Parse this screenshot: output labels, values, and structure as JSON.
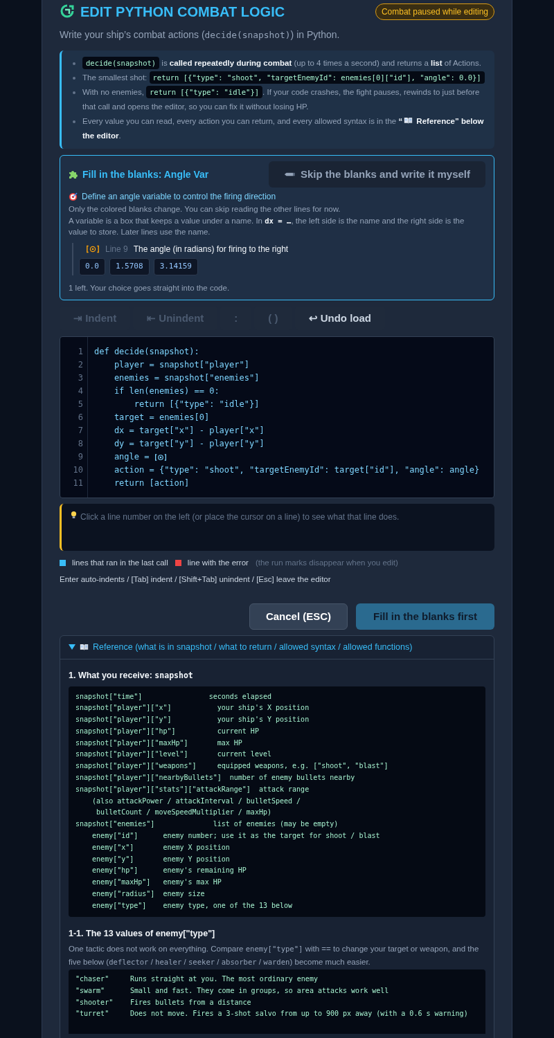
{
  "header": {
    "title": "EDIT PYTHON COMBAT LOGIC",
    "badge": "Combat paused while editing",
    "subtitle": [
      {
        "kind": "text",
        "text": "Write your ship’s combat actions ("
      },
      {
        "kind": "mono",
        "text": "decide(snapshot)"
      },
      {
        "kind": "text",
        "text": ") in Python."
      }
    ]
  },
  "notes": [
    [
      {
        "kind": "code",
        "text": "decide(snapshot)"
      },
      {
        "kind": "text",
        "text": " is "
      },
      {
        "kind": "bold",
        "text": "called repeatedly during combat"
      },
      {
        "kind": "text",
        "text": " (up to 4 times a second) and returns a "
      },
      {
        "kind": "bold",
        "text": "list"
      },
      {
        "kind": "text",
        "text": " of Actions."
      }
    ],
    [
      {
        "kind": "text",
        "text": "The smallest shot: "
      },
      {
        "kind": "code",
        "text": "return [{\"type\": \"shoot\", \"targetEnemyId\": enemies[0][\"id\"], \"angle\": 0.0}]"
      }
    ],
    [
      {
        "kind": "text",
        "text": "With no enemies, "
      },
      {
        "kind": "code",
        "text": "return [{\"type\": \"idle\"}]"
      },
      {
        "kind": "text",
        "text": ". If your code crashes, the fight pauses, rewinds to just before that call and opens the editor, so you can fix it without losing HP."
      }
    ],
    [
      {
        "kind": "text",
        "text": "Every value you can read, every action you can return, and every allowed syntax is in the "
      },
      {
        "kind": "bold",
        "text": "“"
      },
      {
        "kind": "book"
      },
      {
        "kind": "bold",
        "text": " Reference” below the editor"
      },
      {
        "kind": "text",
        "text": "."
      }
    ]
  ],
  "blanks": {
    "title": "Fill in the blanks: Angle Var",
    "skip_button": "Skip the blanks and write it myself",
    "goal": "Define an angle variable to control the firing direction",
    "explanation": [
      [
        {
          "kind": "text",
          "text": "Only the colored blanks change. You can skip reading the other lines for now."
        }
      ],
      [
        {
          "kind": "text",
          "text": "A variable is a box that keeps a value under a name. In "
        },
        {
          "kind": "mono",
          "text": "dx = …"
        },
        {
          "kind": "text",
          "text": ", the left side is the name and the right side is the value to store. Later lines use the name."
        }
      ]
    ],
    "question": {
      "line": "Line 9",
      "prompt": "The angle (in radians) for firing to the right",
      "choices": [
        {
          "label": "0.0",
          "selected": false
        },
        {
          "label": "1.5708",
          "selected": false
        },
        {
          "label": "3.14159",
          "selected": false
        }
      ]
    },
    "remaining": "1 left. Your choice goes straight into the code."
  },
  "toolbar": [
    {
      "label": "⇥ Indent",
      "disabled": true
    },
    {
      "label": "⇤ Unindent",
      "disabled": true
    },
    {
      "label": ":",
      "disabled": true
    },
    {
      "label": "( )",
      "disabled": true
    },
    {
      "label": "↩ Undo load",
      "disabled": false
    }
  ],
  "editor": {
    "lines": [
      {
        "number": "1",
        "text": "def decide(snapshot):"
      },
      {
        "number": "2",
        "text": "    player = snapshot[\"player\"]"
      },
      {
        "number": "3",
        "text": "    enemies = snapshot[\"enemies\"]"
      },
      {
        "number": "4",
        "text": "    if len(enemies) == 0:"
      },
      {
        "number": "5",
        "text": "        return [{\"type\": \"idle\"}]"
      },
      {
        "number": "6",
        "text": "    target = enemies[0]"
      },
      {
        "number": "7",
        "text": "    dx = target[\"x\"] - player[\"x\"]"
      },
      {
        "number": "8",
        "text": "    dy = target[\"y\"] - player[\"y\"]"
      },
      {
        "number": "9",
        "text": "    angle = ",
        "blank": true
      },
      {
        "number": "10",
        "text": "    action = {\"type\": \"shoot\", \"targetEnemyId\": target[\"id\"], \"angle\": angle}"
      },
      {
        "number": "11",
        "text": "    return [action]"
      }
    ]
  },
  "hint": "Click a line number on the left (or place the cursor on a line) to see what that line does.",
  "legend": [
    {
      "color": "#38bdf8",
      "label": "lines that ran in the last call"
    },
    {
      "color": "#ef4444",
      "label": "line with the error"
    }
  ],
  "legend_note": "(the run marks disappear when you edit)",
  "keys": "Enter auto-indents / [Tab] indent / [Shift+Tab] unindent / [Esc] leave the editor",
  "buttons": [
    {
      "label": "Cancel (ESC)",
      "kind": "cancel"
    },
    {
      "label": "Fill in the blanks first",
      "kind": "primary",
      "disabled": true
    }
  ],
  "reference": {
    "title": "Reference (what is in snapshot / what to return / allowed syntax / allowed functions)",
    "expanded": true,
    "section1": {
      "title": [
        {
          "kind": "text",
          "text": "1. What you receive: "
        },
        {
          "kind": "mono",
          "text": "snapshot"
        }
      ],
      "lines": [
        "snapshot[\"time\"]                seconds elapsed",
        "snapshot[\"player\"][\"x\"]           your ship's X position",
        "snapshot[\"player\"][\"y\"]           your ship's Y position",
        "snapshot[\"player\"][\"hp\"]          current HP",
        "snapshot[\"player\"][\"maxHp\"]       max HP",
        "snapshot[\"player\"][\"level\"]       current level",
        "snapshot[\"player\"][\"weapons\"]     equipped weapons, e.g. [\"shoot\", \"blast\"]",
        "snapshot[\"player\"][\"nearbyBullets\"]  number of enemy bullets nearby",
        "snapshot[\"player\"][\"stats\"][\"attackRange\"]  attack range",
        "    (also attackPower / attackInterval / bulletSpeed /",
        "     bulletCount / moveSpeedMultiplier / maxHp)",
        "snapshot[\"enemies\"]              list of enemies (may be empty)",
        "    enemy[\"id\"]      enemy number; use it as the target for shoot / blast",
        "    enemy[\"x\"]       enemy X position",
        "    enemy[\"y\"]       enemy Y position",
        "    enemy[\"hp\"]      enemy's remaining HP",
        "    enemy[\"maxHp\"]   enemy's max HP",
        "    enemy[\"radius\"]  enemy size",
        "    enemy[\"type\"]    enemy type, one of the 13 below"
      ]
    },
    "section2": {
      "title": "1-1. The 13 values of enemy[\"type\"]",
      "intro": [
        {
          "kind": "text",
          "text": "One tactic does not work on everything. Compare "
        },
        {
          "kind": "mono",
          "text": "enemy[\"type\"]"
        },
        {
          "kind": "text",
          "text": " with == to change your target or weapon, and the five below ("
        },
        {
          "kind": "mono",
          "text": "deflector"
        },
        {
          "kind": "text",
          "text": " / "
        },
        {
          "kind": "mono",
          "text": "healer"
        },
        {
          "kind": "text",
          "text": " / "
        },
        {
          "kind": "mono",
          "text": "seeker"
        },
        {
          "kind": "text",
          "text": " / "
        },
        {
          "kind": "mono",
          "text": "absorber"
        },
        {
          "kind": "text",
          "text": " / "
        },
        {
          "kind": "mono",
          "text": "warden"
        },
        {
          "kind": "text",
          "text": ") become much easier."
        }
      ],
      "types": [
        {
          "name": "\"chaser\"",
          "description": "Runs straight at you. The most ordinary enemy"
        },
        {
          "name": "\"swarm\"",
          "description": "Small and fast. They come in groups, so area attacks work well"
        },
        {
          "name": "\"shooter\"",
          "description": "Fires bullets from a distance"
        },
        {
          "name": "\"turret\"",
          "description": "Does not move. Fires a 3-shot salvo from up to 900 px away (with a 0.6 s warning)"
        }
      ]
    }
  }
}
